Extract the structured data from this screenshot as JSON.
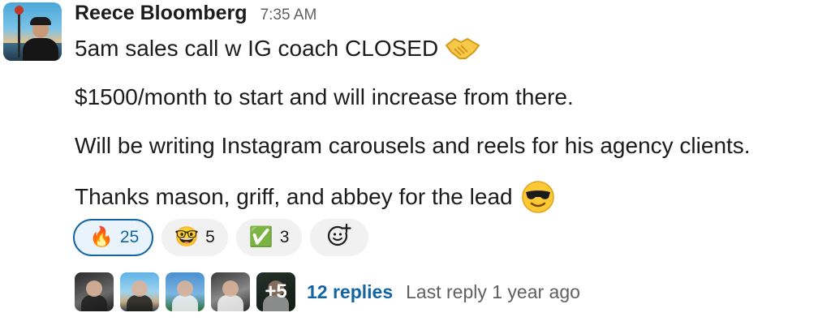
{
  "message": {
    "sender": "Reece Bloomberg",
    "timestamp": "7:35 AM",
    "lines": [
      "5am sales call w IG coach CLOSED",
      "$1500/month to start and will increase from there.",
      "Will be writing Instagram carousels and reels for his agency clients.",
      "Thanks mason, griff, and abbey for the lead"
    ],
    "line_emojis": [
      "handshake",
      "smiling-face-with-sunglasses"
    ]
  },
  "reactions": [
    {
      "emoji": "🔥",
      "name": "fire",
      "count": "25",
      "active": true
    },
    {
      "emoji": "🤓",
      "name": "nerd-face",
      "count": "5",
      "active": false
    },
    {
      "emoji": "✅",
      "name": "white-check-mark",
      "count": "3",
      "active": false
    }
  ],
  "add_reaction_icon": "add-emoji-icon",
  "thread": {
    "overflow": "+5",
    "reply_count": "12 replies",
    "last_reply": "Last reply 1 year ago"
  },
  "colors": {
    "link": "#1264a3",
    "muted": "#616061",
    "text": "#1d1c1d",
    "reaction_bg": "#f1f1f1",
    "reaction_active_bg": "#e8f3fb"
  }
}
